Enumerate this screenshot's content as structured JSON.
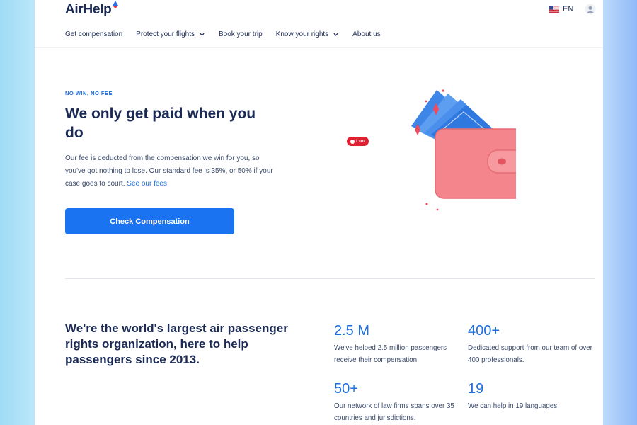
{
  "header": {
    "logo_text": "AirHelp",
    "language": "EN",
    "nav": [
      {
        "label": "Get compensation"
      },
      {
        "label": "Protect your flights"
      },
      {
        "label": "Book your trip"
      },
      {
        "label": "Know your rights"
      },
      {
        "label": "About us"
      }
    ]
  },
  "hero": {
    "eyebrow": "NO WIN, NO FEE",
    "heading": "We only get paid when you do",
    "body": "Our fee is deducted from the compensation we win for you, so you've got nothing to lose. Our standard fee is 35%, or 50% if your case goes to court.",
    "link": "See our fees",
    "cta": "Check Compensation",
    "pin_label": "Lưu"
  },
  "org": {
    "heading": "We're the world's largest air passenger rights organization, here to help passengers since 2013.",
    "stats": [
      {
        "number": "2.5 M",
        "desc": "We've helped 2.5 million passengers receive their compensation."
      },
      {
        "number": "400+",
        "desc": "Dedicated support from our team of over 400 professionals."
      },
      {
        "number": "50+",
        "desc": "Our network of law firms spans over 35 countries and jurisdictions."
      },
      {
        "number": "19",
        "desc": "We can help in 19 languages."
      }
    ]
  },
  "colors": {
    "brand_navy": "#1b2a55",
    "accent_blue": "#1a73f0",
    "wallet_pink": "#f4858c",
    "sparkle_red": "#ef4b5c"
  },
  "icons": [
    "airhelp-logo-mark",
    "us-flag-icon",
    "user-icon",
    "chevron-down-icon",
    "wallet-illustration",
    "pinterest-icon"
  ]
}
